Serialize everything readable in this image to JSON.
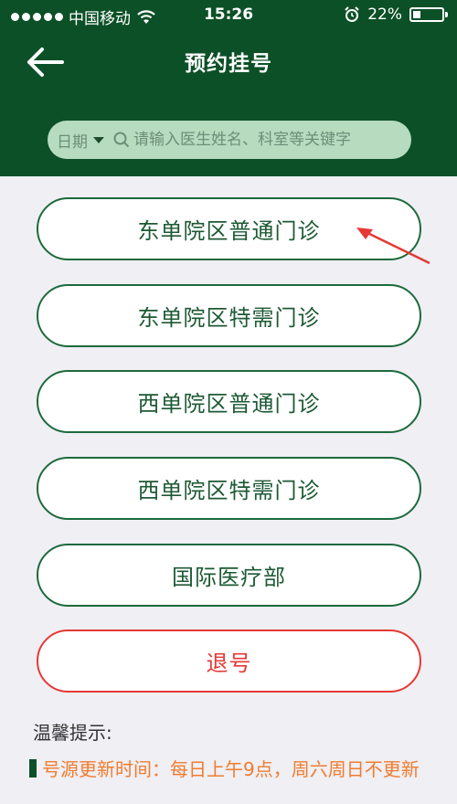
{
  "status_bar": {
    "carrier": "中国移动",
    "time": "15:26",
    "battery_percent": "22%"
  },
  "header": {
    "title": "预约挂号"
  },
  "search": {
    "date_label": "日期",
    "placeholder": "请输入医生姓名、科室等关键字"
  },
  "buttons": [
    {
      "label": "东单院区普通门诊"
    },
    {
      "label": "东单院区特需门诊"
    },
    {
      "label": "西单院区普通门诊"
    },
    {
      "label": "西单院区特需门诊"
    },
    {
      "label": "国际医疗部"
    },
    {
      "label": "退号"
    }
  ],
  "tips": {
    "title": "温馨提示:",
    "text": "号源更新时间：每日上午9点，周六周日不更新"
  },
  "colors": {
    "header_bg": "#0c5027",
    "button_border": "#1d6a3c",
    "cancel_red": "#e53935",
    "tip_orange": "#f07c2e",
    "page_bg": "#efeff4"
  }
}
